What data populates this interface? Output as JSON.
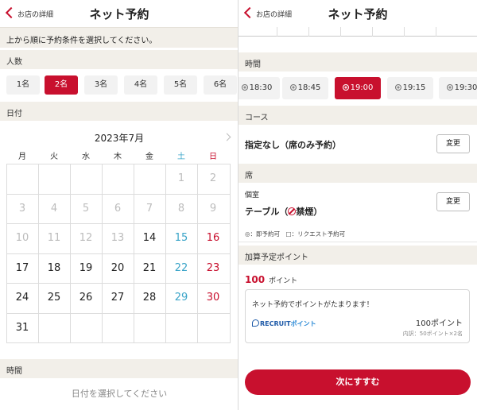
{
  "left_panel": {
    "back_label": "お店の詳細",
    "title": "ネット予約",
    "instruction": "上から順に予約条件を選択してください。",
    "party": {
      "heading": "人数",
      "options": [
        "1名",
        "2名",
        "3名",
        "4名",
        "5名",
        "6名"
      ],
      "selected": "2名"
    },
    "date": {
      "heading": "日付",
      "month_label": "2023年7月",
      "weekdays": [
        "月",
        "火",
        "水",
        "木",
        "金",
        "土",
        "日"
      ],
      "weeks": [
        [
          "",
          "",
          "",
          "",
          "",
          "1",
          "2"
        ],
        [
          "3",
          "4",
          "5",
          "6",
          "7",
          "8",
          "9"
        ],
        [
          "10",
          "11",
          "12",
          "13",
          "14",
          "15",
          "16"
        ],
        [
          "17",
          "18",
          "19",
          "20",
          "21",
          "22",
          "23"
        ],
        [
          "24",
          "25",
          "26",
          "27",
          "28",
          "29",
          "30"
        ],
        [
          "31",
          "",
          "",
          "",
          "",
          "",
          ""
        ]
      ],
      "unavailable_days": [
        "1",
        "2",
        "3",
        "4",
        "5",
        "6",
        "7",
        "8",
        "9",
        "10",
        "11",
        "12",
        "13"
      ]
    },
    "time": {
      "heading": "時間",
      "placeholder": "日付を選択してください"
    }
  },
  "right_panel": {
    "back_label": "お店の詳細",
    "title": "ネット予約",
    "time": {
      "heading": "時間",
      "options": [
        "18:30",
        "18:45",
        "19:00",
        "19:15",
        "19:30"
      ],
      "selected": "19:00",
      "mark_icon": "double-circle-icon"
    },
    "course": {
      "heading": "コース",
      "value": "指定なし（席のみ予約）",
      "change_label": "変更"
    },
    "seat": {
      "heading": "席",
      "type": "個室",
      "value_prefix": "テーブル（",
      "value_suffix": "禁煙）",
      "change_label": "変更",
      "legend": "◎：即予約可　□：リクエスト予約可"
    },
    "points": {
      "heading": "加算予定ポイント",
      "amount": "100",
      "unit": "ポイント",
      "card_title": "ネット予約でポイントがたまります！",
      "brand": "RECRUIT",
      "brand_suffix": "ポイント",
      "card_points": "100ポイント",
      "breakdown": "内訳：50ポイント×2名"
    },
    "next_label": "次にすすむ"
  },
  "colors": {
    "accent": "#c8102e",
    "saturday": "#3aa4c8",
    "section_bg": "#f2efe9",
    "brand_blue": "#1e5aa8"
  }
}
